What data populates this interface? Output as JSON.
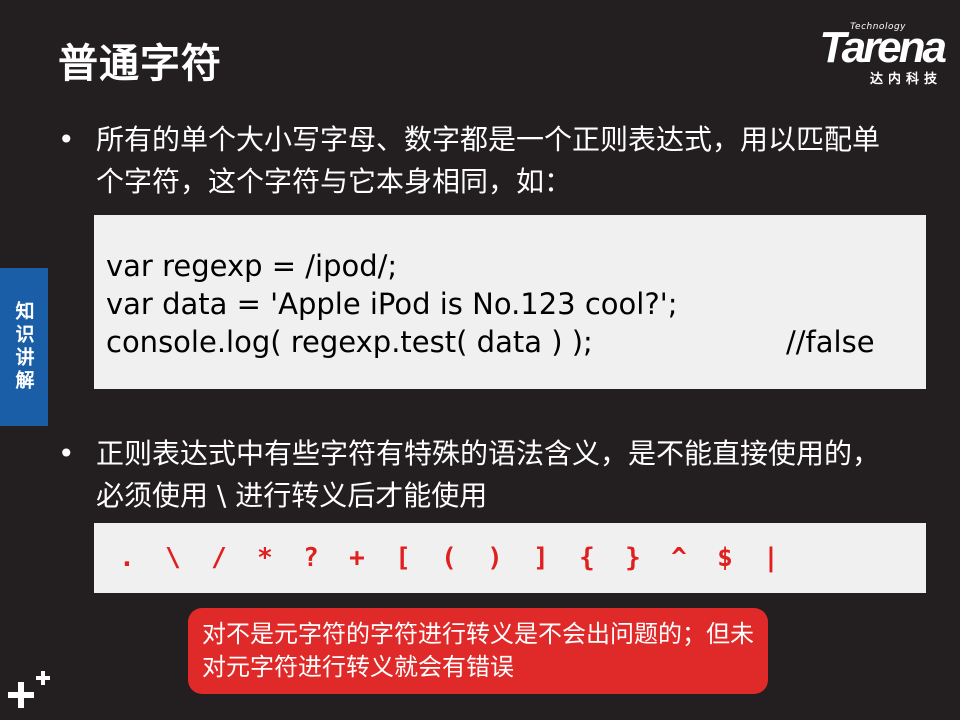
{
  "slide": {
    "title": "普通字符",
    "side_tab": "知识讲解"
  },
  "logo": {
    "small": "Technology",
    "main": "Tarena",
    "sub": "达内科技"
  },
  "bullets": [
    {
      "marker": "•",
      "text": "所有的单个大小写字母、数字都是一个正则表达式，用以匹配单个字符，这个字符与它本身相同，如："
    },
    {
      "marker": "•",
      "text": "正则表达式中有些字符有特殊的语法含义，是不能直接使用的，必须使用 \\ 进行转义后才能使用"
    }
  ],
  "code": {
    "line1": "var regexp = /ipod/;",
    "line2": "var data = 'Apple iPod is No.123 cool?';",
    "line3": "console.log( regexp.test( data ) );",
    "line3_comment": "//false"
  },
  "symbols": [
    ".",
    "\\",
    "/",
    "*",
    "?",
    "+",
    "[",
    "(",
    ")",
    "]",
    "{",
    "}",
    "^",
    "$",
    "|"
  ],
  "callout": {
    "text": "对不是元字符的字符进行转义是不会出问题的；但未对元字符进行转义就会有错误"
  },
  "colors": {
    "background": "#231f20",
    "accent_blue": "#1b5ea8",
    "accent_red": "#e02a29",
    "code_bg": "#f0f0f0"
  }
}
